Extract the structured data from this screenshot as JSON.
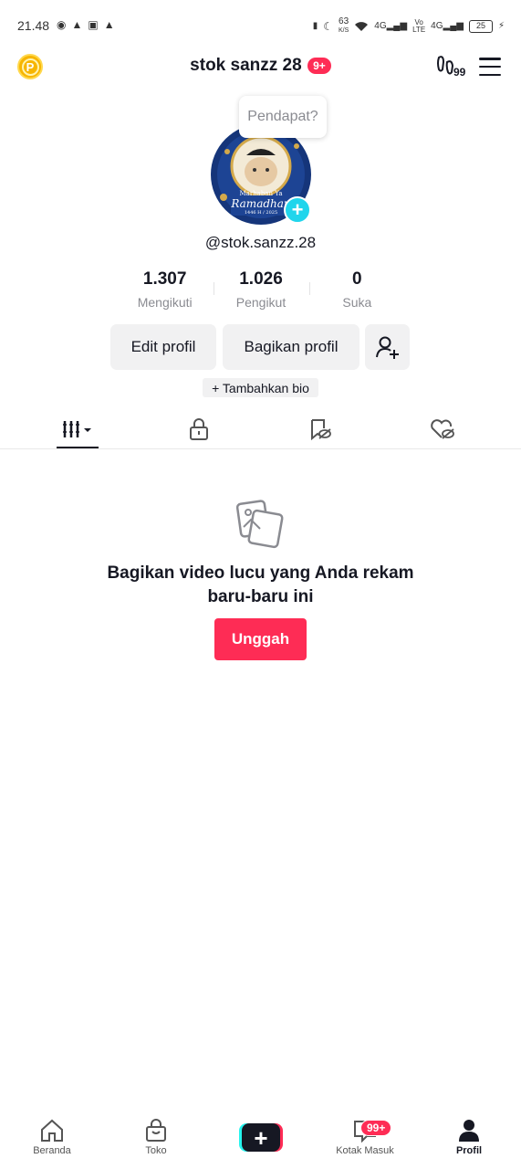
{
  "status_bar": {
    "time": "21.48",
    "network_speed": "63",
    "network_unit": "K/S",
    "net1": "4G",
    "net2_top": "Vo",
    "net2_bottom": "LTE",
    "net3": "4G",
    "battery": "25"
  },
  "header": {
    "coin_letter": "P",
    "title": "stok sanzz 28",
    "notification_badge": "9+",
    "footprint_count": "99"
  },
  "profile": {
    "tooltip": "Pendapat?",
    "avatar_caption_top": "Marhaban Ya",
    "avatar_caption_main": "Ramadhan",
    "avatar_caption_year": "1446 H / 2025",
    "username": "@stok.sanzz.28"
  },
  "stats": [
    {
      "value": "1.307",
      "label": "Mengikuti"
    },
    {
      "value": "1.026",
      "label": "Pengikut"
    },
    {
      "value": "0",
      "label": "Suka"
    }
  ],
  "buttons": {
    "edit_profile": "Edit profil",
    "share_profile": "Bagikan profil",
    "add_bio": "+ Tambahkan bio"
  },
  "tabs": [
    {
      "icon": "videos-grid-icon"
    },
    {
      "icon": "lock-icon"
    },
    {
      "icon": "bookmark-hidden-icon"
    },
    {
      "icon": "heart-hidden-icon"
    }
  ],
  "empty_state": {
    "line1": "Bagikan video lucu yang Anda rekam",
    "line2": "baru-baru ini",
    "upload_label": "Unggah"
  },
  "bottom_nav": {
    "home": "Beranda",
    "shop": "Toko",
    "inbox": "Kotak Masuk",
    "inbox_badge": "99+",
    "profile": "Profil"
  },
  "colors": {
    "accent": "#fe2c55",
    "cyan": "#25f4ee",
    "text": "#161823",
    "muted": "#8a8b91"
  }
}
